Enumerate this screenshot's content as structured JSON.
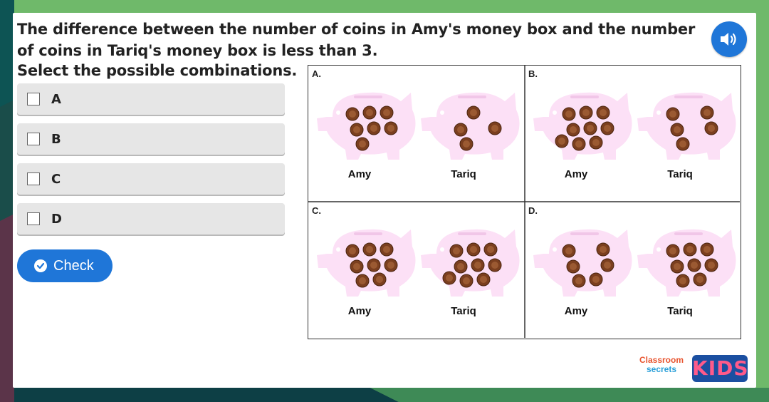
{
  "question": {
    "text": "The difference between the number of coins in Amy's money box and the number of coins in Tariq's money box is less than 3.",
    "instruction": "Select the possible combinations."
  },
  "options": [
    {
      "label": "A",
      "checked": false
    },
    {
      "label": "B",
      "checked": false
    },
    {
      "label": "C",
      "checked": false
    },
    {
      "label": "D",
      "checked": false
    }
  ],
  "check_button": {
    "label": "Check"
  },
  "audio_button": {
    "icon": "speaker-icon"
  },
  "panels": [
    {
      "letter": "A.",
      "left": {
        "name": "Amy",
        "coins": 7
      },
      "right": {
        "name": "Tariq",
        "coins": 4
      }
    },
    {
      "letter": "B.",
      "left": {
        "name": "Amy",
        "coins": 9
      },
      "right": {
        "name": "Tariq",
        "coins": 5
      }
    },
    {
      "letter": "C.",
      "left": {
        "name": "Amy",
        "coins": 8
      },
      "right": {
        "name": "Tariq",
        "coins": 9
      }
    },
    {
      "letter": "D.",
      "left": {
        "name": "Amy",
        "coins": 6
      },
      "right": {
        "name": "Tariq",
        "coins": 8
      }
    }
  ],
  "logo": {
    "top": "Classroom",
    "bottom": "secrets",
    "kids": "KIDS"
  },
  "colors": {
    "background_green": "#6fb96a",
    "accent_blue": "#1f76d8",
    "pig_pink": "#fce0f6",
    "coin_brown": "#7b3f1f"
  }
}
